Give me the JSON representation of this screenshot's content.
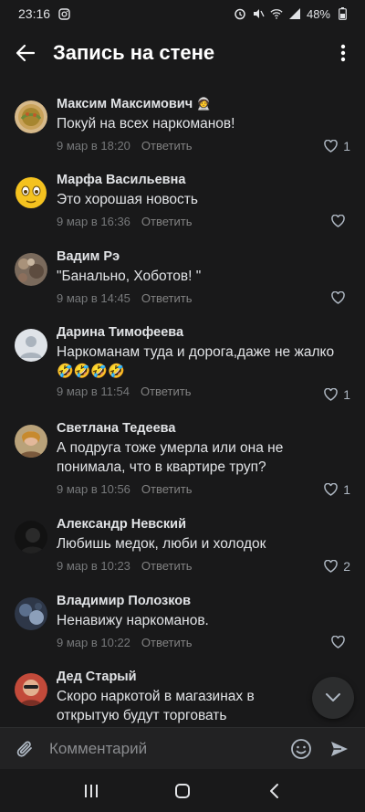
{
  "status_bar": {
    "time": "23:16",
    "battery": "48%"
  },
  "header": {
    "title": "Запись на стене"
  },
  "comments": [
    {
      "name": "Максим Максимович",
      "name_emoji": "🧑‍🚀",
      "text": "Покуй на всех наркоманов!",
      "date": "9 мар в 18:20",
      "reply": "Ответить",
      "likes": "1"
    },
    {
      "name": "Марфа Васильевна",
      "text": "Это хорошая новость",
      "date": "9 мар в 16:36",
      "reply": "Ответить",
      "likes": ""
    },
    {
      "name": "Вадим Рэ",
      "text": "\"Банально, Хоботов! \"",
      "date": "9 мар в 14:45",
      "reply": "Ответить",
      "likes": ""
    },
    {
      "name": "Дарина Тимофеева",
      "text": "Наркоманам туда и дорога,даже не жалко",
      "emojis": "🤣🤣🤣🤣",
      "date": "9 мар в 11:54",
      "reply": "Ответить",
      "likes": "1"
    },
    {
      "name": "Светлана Тедеева",
      "text": "А подруга тоже умерла или она не понимала, что в квартире труп?",
      "date": "9 мар в 10:56",
      "reply": "Ответить",
      "likes": "1"
    },
    {
      "name": "Александр Невский",
      "text": "Любишь медок, люби и холодок",
      "date": "9 мар в 10:23",
      "reply": "Ответить",
      "likes": "2"
    },
    {
      "name": "Владимир Полозков",
      "text": "Ненавижу наркоманов.",
      "date": "9 мар в 10:22",
      "reply": "Ответить",
      "likes": ""
    },
    {
      "name": "Дед Старый",
      "text": "Скоро наркотой в магазинах в открытую будут торговать",
      "date": "",
      "reply": "",
      "likes": ""
    }
  ],
  "composer": {
    "placeholder": "Комментарий"
  },
  "icons": {
    "back": "arrow-left-icon",
    "more": "more-vertical-icon",
    "like": "heart-icon",
    "attach": "paperclip-icon",
    "emoji": "smile-icon",
    "send": "send-icon",
    "scroll": "chevron-down-icon"
  },
  "colors": {
    "background": "#19191a",
    "text": "#e1e3e6",
    "secondary": "#76787a",
    "panel": "#222223"
  }
}
